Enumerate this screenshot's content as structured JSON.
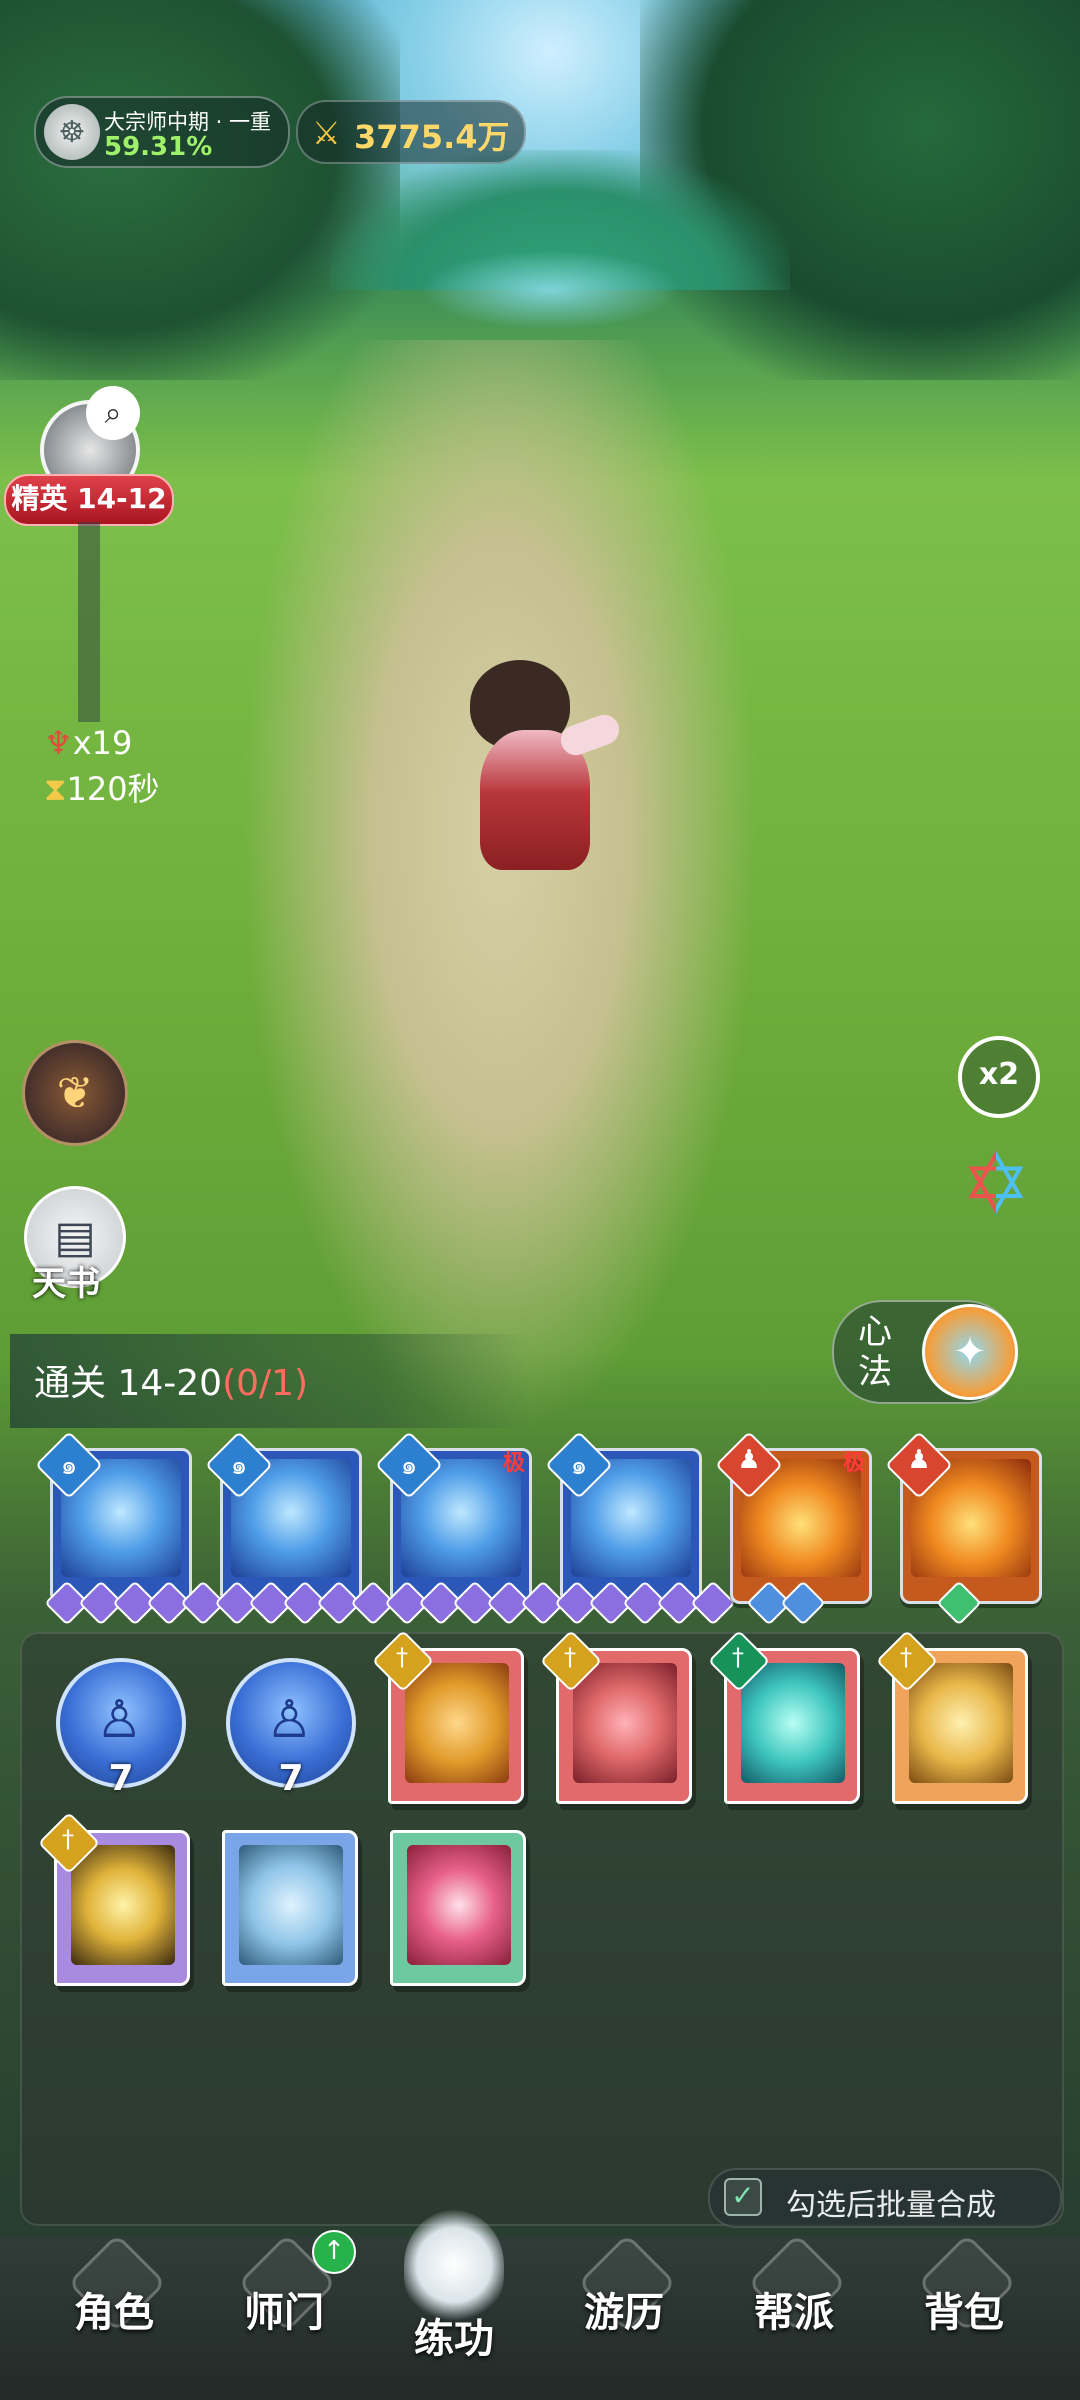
{
  "hud": {
    "rank_title": "大宗师中期 · 一重",
    "rank_progress": "59.31%",
    "power": "3775.4万"
  },
  "stage": {
    "tag": "精英 14-12",
    "kill_count": "x19",
    "time_left": "120秒"
  },
  "side": {
    "book_label": "天书",
    "speed_label": "x2"
  },
  "progress": {
    "clear_prefix": "通关 14-20",
    "clear_count": "(0/1)"
  },
  "xinfa": {
    "label": "心法"
  },
  "equipped": [
    {
      "name": "skill-fist",
      "theme": "blue",
      "stars": 5,
      "star_color": "purple",
      "tag": ""
    },
    {
      "name": "skill-claw",
      "theme": "blue",
      "stars": 5,
      "star_color": "purple",
      "tag": ""
    },
    {
      "name": "skill-pillars",
      "theme": "blue",
      "stars": 5,
      "star_color": "purple",
      "tag": "极"
    },
    {
      "name": "skill-shards",
      "theme": "blue",
      "stars": 5,
      "star_color": "purple",
      "tag": ""
    },
    {
      "name": "skill-palm",
      "theme": "fire",
      "stars": 2,
      "star_color": "blue",
      "tag": "极"
    },
    {
      "name": "skill-meditate",
      "theme": "fire",
      "stars": 1,
      "star_color": "green",
      "tag": ""
    }
  ],
  "bag": {
    "orb_counts": [
      "7",
      "7"
    ],
    "merge_label": "勾选后批量合成"
  },
  "nav": {
    "items": [
      "角色",
      "师门",
      "练功",
      "游历",
      "帮派",
      "背包"
    ],
    "active": "练功"
  },
  "colors": {
    "progress_green": "#9ff06a",
    "power_gold": "#ffd86a",
    "stage_red": "#c21e28",
    "clear_count_red": "#ff6d5e"
  }
}
